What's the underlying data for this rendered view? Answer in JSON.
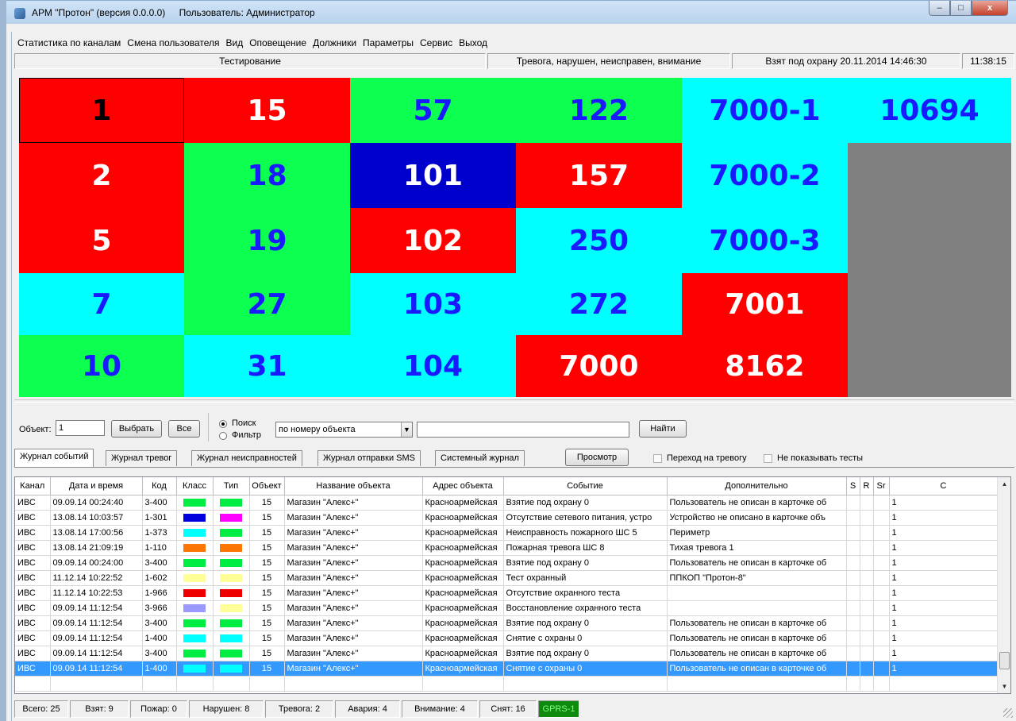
{
  "window": {
    "app_title": "АРМ \"Протон\" (версия 0.0.0.0)",
    "user_label": "Пользователь: Администратор",
    "minimize": "–",
    "maximize": "□",
    "close": "x"
  },
  "menu": [
    "Статистика по каналам",
    "Смена пользователя",
    "Вид",
    "Оповещение",
    "Должники",
    "Параметры",
    "Сервис",
    "Выход"
  ],
  "status": {
    "mode": "Тестирование",
    "legend": "Тревога, нарушен, неисправен, внимание",
    "armed": "Взят под охрану 20.11.2014 14:46:30",
    "time": "11:38:15"
  },
  "colors": {
    "red": "#ff0000",
    "green": "#0dff50",
    "cyan": "#00ffff",
    "blue": "#0000cc",
    "gray": "#808080",
    "dark_blue_text": "#1a1aff",
    "black_text": "#000000",
    "white_text": "#ffffff"
  },
  "tiles": [
    {
      "label": "1",
      "bg": "red",
      "fg": "black",
      "selected": true
    },
    {
      "label": "15",
      "bg": "red",
      "fg": "white"
    },
    {
      "label": "57",
      "bg": "green",
      "fg": "blue"
    },
    {
      "label": "122",
      "bg": "green",
      "fg": "blue"
    },
    {
      "label": "7000-1",
      "bg": "cyan",
      "fg": "blue"
    },
    {
      "label": "10694",
      "bg": "cyan",
      "fg": "blue"
    },
    {
      "label": "2",
      "bg": "red",
      "fg": "white"
    },
    {
      "label": "18",
      "bg": "green",
      "fg": "blue"
    },
    {
      "label": "101",
      "bg": "blue",
      "fg": "white"
    },
    {
      "label": "157",
      "bg": "red",
      "fg": "white"
    },
    {
      "label": "7000-2",
      "bg": "cyan",
      "fg": "blue"
    },
    {
      "label": "",
      "bg": "gray",
      "fg": "white"
    },
    {
      "label": "5",
      "bg": "red",
      "fg": "white"
    },
    {
      "label": "19",
      "bg": "green",
      "fg": "blue"
    },
    {
      "label": "102",
      "bg": "red",
      "fg": "white"
    },
    {
      "label": "250",
      "bg": "cyan",
      "fg": "blue"
    },
    {
      "label": "7000-3",
      "bg": "cyan",
      "fg": "blue"
    },
    {
      "label": "",
      "bg": "gray",
      "fg": "white"
    },
    {
      "label": "7",
      "bg": "cyan",
      "fg": "blue"
    },
    {
      "label": "27",
      "bg": "green",
      "fg": "blue"
    },
    {
      "label": "103",
      "bg": "cyan",
      "fg": "blue"
    },
    {
      "label": "272",
      "bg": "cyan",
      "fg": "blue"
    },
    {
      "label": "7001",
      "bg": "red",
      "fg": "white"
    },
    {
      "label": "",
      "bg": "gray",
      "fg": "white"
    },
    {
      "label": "10",
      "bg": "green",
      "fg": "blue"
    },
    {
      "label": "31",
      "bg": "cyan",
      "fg": "blue"
    },
    {
      "label": "104",
      "bg": "cyan",
      "fg": "blue"
    },
    {
      "label": "7000",
      "bg": "red",
      "fg": "white"
    },
    {
      "label": "8162",
      "bg": "red",
      "fg": "white"
    },
    {
      "label": "",
      "bg": "gray",
      "fg": "white"
    }
  ],
  "search": {
    "object_label": "Объект:",
    "object_value": "1",
    "select_button": "Выбрать",
    "all_button": "Все",
    "radio_search": "Поиск",
    "radio_filter": "Фильтр",
    "mode_value": "по номеру объекта",
    "query_value": "",
    "find_button": "Найти"
  },
  "tabs": [
    "Журнал событий",
    "Журнал тревог",
    "Журнал неисправностей",
    "Журнал отправки SMS",
    "Системный журнал"
  ],
  "toolbar": {
    "view_button": "Просмотр",
    "goto_alarm": "Переход на тревогу",
    "hide_tests": "Не показывать тесты"
  },
  "table": {
    "columns": [
      "Канал",
      "Дата и время",
      "Код",
      "Класс",
      "Тип",
      "Объект",
      "Название объекта",
      "Адрес объекта",
      "Событие",
      "Дополнительно",
      "S",
      "R",
      "Sr",
      "C"
    ],
    "rows": [
      {
        "channel": "ИВС",
        "datetime": "09.09.14  00:24:40",
        "code": "3-400",
        "class_color": "#00ee44",
        "type_color": "#00ee44",
        "object": "15",
        "name": "Магазин \"Алекс+\"",
        "address": "Красноармейская",
        "event": "Взятие под охрану 0",
        "extra": "Пользователь не описан в карточке об",
        "c": "1"
      },
      {
        "channel": "ИВС",
        "datetime": "13.08.14  10:03:57",
        "code": "1-301",
        "class_color": "#0000dd",
        "type_color": "#ff00ff",
        "object": "15",
        "name": "Магазин \"Алекс+\"",
        "address": "Красноармейская",
        "event": "Отсутствие сетевого питания, устро",
        "extra": "Устройство не описано в карточке объ",
        "c": "1"
      },
      {
        "channel": "ИВС",
        "datetime": "13.08.14  17:00:56",
        "code": "1-373",
        "class_color": "#00ffff",
        "type_color": "#00ee44",
        "object": "15",
        "name": "Магазин \"Алекс+\"",
        "address": "Красноармейская",
        "event": "Неисправность пожарного ШС 5",
        "extra": "Периметр",
        "c": "1"
      },
      {
        "channel": "ИВС",
        "datetime": "13.08.14  21:09:19",
        "code": "1-110",
        "class_color": "#ff7700",
        "type_color": "#ff7700",
        "object": "15",
        "name": "Магазин \"Алекс+\"",
        "address": "Красноармейская",
        "event": "Пожарная тревога ШС 8",
        "extra": "Тихая тревога 1",
        "c": "1"
      },
      {
        "channel": "ИВС",
        "datetime": "09.09.14  00:24:00",
        "code": "3-400",
        "class_color": "#00ee44",
        "type_color": "#00ee44",
        "object": "15",
        "name": "Магазин \"Алекс+\"",
        "address": "Красноармейская",
        "event": "Взятие под охрану 0",
        "extra": "Пользователь не описан в карточке об",
        "c": "1"
      },
      {
        "channel": "ИВС",
        "datetime": "11.12.14  10:22:52",
        "code": "1-602",
        "class_color": "#ffff99",
        "type_color": "#ffff99",
        "object": "15",
        "name": "Магазин \"Алекс+\"",
        "address": "Красноармейская",
        "event": "Тест охранный",
        "extra": "ППКОП \"Протон-8\"",
        "c": "1"
      },
      {
        "channel": "ИВС",
        "datetime": "11.12.14  10:22:53",
        "code": "1-966",
        "class_color": "#ee0000",
        "type_color": "#ee0000",
        "object": "15",
        "name": "Магазин \"Алекс+\"",
        "address": "Красноармейская",
        "event": "Отсутствие охранного теста",
        "extra": "",
        "c": "1"
      },
      {
        "channel": "ИВС",
        "datetime": "09.09.14  11:12:54",
        "code": "3-966",
        "class_color": "#9999ff",
        "type_color": "#ffff99",
        "object": "15",
        "name": "Магазин \"Алекс+\"",
        "address": "Красноармейская",
        "event": "Восстановление охранного теста",
        "extra": "",
        "c": "1"
      },
      {
        "channel": "ИВС",
        "datetime": "09.09.14  11:12:54",
        "code": "3-400",
        "class_color": "#00ee44",
        "type_color": "#00ee44",
        "object": "15",
        "name": "Магазин \"Алекс+\"",
        "address": "Красноармейская",
        "event": "Взятие под охрану 0",
        "extra": "Пользователь не описан в карточке об",
        "c": "1"
      },
      {
        "channel": "ИВС",
        "datetime": "09.09.14  11:12:54",
        "code": "1-400",
        "class_color": "#00ffff",
        "type_color": "#00ffff",
        "object": "15",
        "name": "Магазин \"Алекс+\"",
        "address": "Красноармейская",
        "event": "Снятие с охраны 0",
        "extra": "Пользователь не описан в карточке об",
        "c": "1"
      },
      {
        "channel": "ИВС",
        "datetime": "09.09.14  11:12:54",
        "code": "3-400",
        "class_color": "#00ee44",
        "type_color": "#00ee44",
        "object": "15",
        "name": "Магазин \"Алекс+\"",
        "address": "Красноармейская",
        "event": "Взятие под охрану 0",
        "extra": "Пользователь не описан в карточке об",
        "c": "1"
      },
      {
        "channel": "ИВС",
        "datetime": "09.09.14  11:12:54",
        "code": "1-400",
        "class_color": "#00ffff",
        "type_color": "#00ffff",
        "object": "15",
        "name": "Магазин \"Алекс+\"",
        "address": "Красноармейская",
        "event": "Снятие с охраны 0",
        "extra": "Пользователь не описан в карточке об",
        "c": "1",
        "selected": true
      }
    ]
  },
  "footer": [
    "Всего: 25",
    "Взят: 9",
    "Пожар: 0",
    "Нарушен: 8",
    "Тревога: 2",
    "Авария: 4",
    "Внимание: 4",
    "Снят: 16",
    "GPRS-1"
  ],
  "footer_highlight_color": "#0f8a0f"
}
